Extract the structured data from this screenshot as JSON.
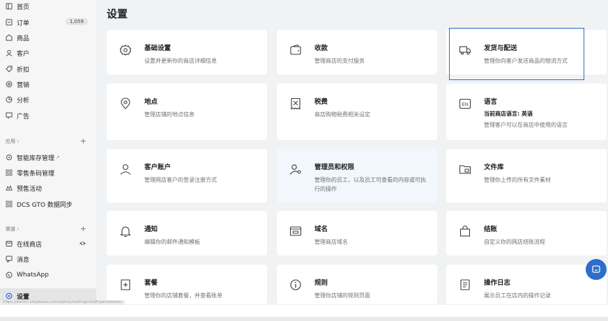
{
  "page_title": "设置",
  "sidebar": {
    "items": [
      {
        "label": "首页",
        "icon": "home-icon"
      },
      {
        "label": "订单",
        "icon": "orders-icon",
        "badge": "1,059"
      },
      {
        "label": "商品",
        "icon": "tag-icon"
      },
      {
        "label": "客户",
        "icon": "person-icon"
      },
      {
        "label": "折扣",
        "icon": "discount-icon"
      },
      {
        "label": "营销",
        "icon": "target-icon"
      },
      {
        "label": "分析",
        "icon": "chart-icon"
      },
      {
        "label": "广告",
        "icon": "megaphone-icon"
      }
    ],
    "apps_section": {
      "label": "应用 ›",
      "items": [
        {
          "label": "智能库存管理",
          "icon": "app-icon",
          "external": "↗"
        },
        {
          "label": "零售条码管理",
          "icon": "app-icon"
        },
        {
          "label": "预售活动",
          "icon": "app-icon"
        },
        {
          "label": "DCS GTO 数据同步",
          "icon": "app-icon"
        }
      ]
    },
    "channels_section": {
      "label": "渠道 ›",
      "items": [
        {
          "label": "在线商店",
          "icon": "store-icon"
        },
        {
          "label": "消息",
          "icon": "message-icon"
        },
        {
          "label": "WhatsApp",
          "icon": "whatsapp-icon"
        }
      ]
    },
    "settings_item": {
      "label": "设置",
      "icon": "settings-icon"
    }
  },
  "cards": [
    {
      "title": "基础设置",
      "desc": "设置并更新你的商店详细信息",
      "icon": "gear-icon"
    },
    {
      "title": "收款",
      "desc": "管理商店的支付服务",
      "icon": "wallet-icon"
    },
    {
      "title": "发货与配送",
      "desc": "管理你向客户发送商品的物流方式",
      "icon": "truck-icon"
    },
    {
      "title": "地点",
      "desc": "管理店铺的地点信息",
      "icon": "location-icon"
    },
    {
      "title": "税费",
      "desc": "商店购物税费相关设定",
      "icon": "receipt-icon"
    },
    {
      "title": "语言",
      "subtitle": "当前商店语言: 英语",
      "desc": "管理客户可以在商店中使用的语言",
      "icon": "language-icon",
      "icon_text": "EN"
    },
    {
      "title": "客户账户",
      "desc": "管理网店客户的登录注册方式",
      "icon": "account-icon"
    },
    {
      "title": "管理员和权限",
      "desc": "管理你的员工，以及员工可查看的内容或可执行的操作",
      "icon": "staff-icon"
    },
    {
      "title": "文件库",
      "desc": "管理你上传的所有文件素材",
      "icon": "folder-icon"
    },
    {
      "title": "通知",
      "desc": "编辑你的邮件通知模板",
      "icon": "bell-icon"
    },
    {
      "title": "域名",
      "desc": "管理商店域名",
      "icon": "domain-icon"
    },
    {
      "title": "结账",
      "desc": "自定义你的网店结账流程",
      "icon": "bag-icon"
    },
    {
      "title": "套餐",
      "desc": "管理你的店铺套餐，并查看账单",
      "icon": "plan-icon"
    },
    {
      "title": "规则",
      "desc": "管理你店铺的规则页面",
      "icon": "info-icon"
    },
    {
      "title": "操作日志",
      "desc": "展示员工在店内的操作记录",
      "icon": "log-icon"
    }
  ],
  "status_url": "https://admin.shoplazza.com/admin/settings/staff-permissions",
  "colors": {
    "accent": "#2c6ecb",
    "background": "#f1f2f4",
    "card": "#ffffff",
    "card_highlight": "#f2f7fe"
  }
}
